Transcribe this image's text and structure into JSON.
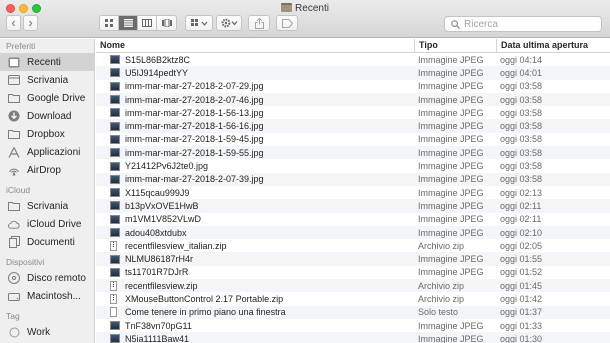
{
  "window": {
    "title": "Recenti",
    "search_placeholder": "Ricerca"
  },
  "toolbar": {
    "back_glyph": "‹",
    "forward_glyph": "›",
    "view_icons": [
      "grid-view-icon",
      "list-view-icon",
      "column-view-icon",
      "gallery-view-icon"
    ],
    "active_view": "list-view-icon"
  },
  "sidebar": {
    "sections": [
      {
        "title": "Preferiti",
        "items": [
          {
            "label": "Recenti",
            "icon": "clock-icon",
            "selected": true
          },
          {
            "label": "Scrivania",
            "icon": "desktop-icon"
          },
          {
            "label": "Google Drive",
            "icon": "folder-icon"
          },
          {
            "label": "Download",
            "icon": "download-icon"
          },
          {
            "label": "Dropbox",
            "icon": "folder-icon"
          },
          {
            "label": "Applicazioni",
            "icon": "applications-icon"
          },
          {
            "label": "AirDrop",
            "icon": "airdrop-icon"
          }
        ]
      },
      {
        "title": "iCloud",
        "items": [
          {
            "label": "Scrivania",
            "icon": "folder-icon"
          },
          {
            "label": "iCloud Drive",
            "icon": "cloud-icon"
          },
          {
            "label": "Documenti",
            "icon": "document-icon"
          }
        ]
      },
      {
        "title": "Dispositivi",
        "items": [
          {
            "label": "Disco remoto",
            "icon": "disc-icon"
          },
          {
            "label": "Macintosh...",
            "icon": "harddrive-icon"
          }
        ]
      },
      {
        "title": "Tag",
        "items": [
          {
            "label": "Work",
            "icon": "tag-icon"
          }
        ]
      }
    ]
  },
  "list": {
    "columns": {
      "name": "Nome",
      "type": "Tipo",
      "date": "Data ultima apertura"
    },
    "rows": [
      {
        "name": "S15L86B2ktz8C",
        "type": "Immagine JPEG",
        "date": "oggi 04:14",
        "kind": "jpeg"
      },
      {
        "name": "U5IJ914pedtYY",
        "type": "Immagine JPEG",
        "date": "oggi 04:01",
        "kind": "jpeg"
      },
      {
        "name": "imm-mar-mar-27-2018-2-07-29.jpg",
        "type": "Immagine JPEG",
        "date": "oggi 03:58",
        "kind": "jpeg"
      },
      {
        "name": "imm-mar-mar-27-2018-2-07-46.jpg",
        "type": "Immagine JPEG",
        "date": "oggi 03:58",
        "kind": "jpeg"
      },
      {
        "name": "imm-mar-mar-27-2018-1-56-13.jpg",
        "type": "Immagine JPEG",
        "date": "oggi 03:58",
        "kind": "jpeg"
      },
      {
        "name": "imm-mar-mar-27-2018-1-56-16.jpg",
        "type": "Immagine JPEG",
        "date": "oggi 03:58",
        "kind": "jpeg"
      },
      {
        "name": "imm-mar-mar-27-2018-1-59-45.jpg",
        "type": "Immagine JPEG",
        "date": "oggi 03:58",
        "kind": "jpeg"
      },
      {
        "name": "imm-mar-mar-27-2018-1-59-55.jpg",
        "type": "Immagine JPEG",
        "date": "oggi 03:58",
        "kind": "jpeg"
      },
      {
        "name": "Y21412Pv6J2te0.jpg",
        "type": "Immagine JPEG",
        "date": "oggi 03:58",
        "kind": "jpeg"
      },
      {
        "name": "imm-mar-mar-27-2018-2-07-39.jpg",
        "type": "Immagine JPEG",
        "date": "oggi 03:58",
        "kind": "jpeg"
      },
      {
        "name": "X115qcau999J9",
        "type": "Immagine JPEG",
        "date": "oggi 02:13",
        "kind": "jpeg"
      },
      {
        "name": "b13pVxOVE1HwB",
        "type": "Immagine JPEG",
        "date": "oggi 02:11",
        "kind": "jpeg"
      },
      {
        "name": "m1VM1V852VLwD",
        "type": "Immagine JPEG",
        "date": "oggi 02:11",
        "kind": "jpeg"
      },
      {
        "name": "adou408xtdubx",
        "type": "Immagine JPEG",
        "date": "oggi 02:10",
        "kind": "jpeg"
      },
      {
        "name": "recentfilesview_italian.zip",
        "type": "Archivio zip",
        "date": "oggi 02:05",
        "kind": "zip"
      },
      {
        "name": "NLMU86187rH4r",
        "type": "Immagine JPEG",
        "date": "oggi 01:55",
        "kind": "jpeg"
      },
      {
        "name": "ts11701R7DJrR",
        "type": "Immagine JPEG",
        "date": "oggi 01:52",
        "kind": "jpeg"
      },
      {
        "name": "recentfilesview.zip",
        "type": "Archivio zip",
        "date": "oggi 01:45",
        "kind": "zip"
      },
      {
        "name": "XMouseButtonControl 2.17 Portable.zip",
        "type": "Archivio zip",
        "date": "oggi 01:42",
        "kind": "zip"
      },
      {
        "name": "Come tenere in primo piano una finestra",
        "type": "Solo testo",
        "date": "oggi 01:37",
        "kind": "txt"
      },
      {
        "name": "TnF38vn70pG11",
        "type": "Immagine JPEG",
        "date": "oggi 01:33",
        "kind": "jpeg"
      },
      {
        "name": "N5ia1111Baw41",
        "type": "Immagine JPEG",
        "date": "oggi 01:30",
        "kind": "jpeg"
      }
    ]
  }
}
